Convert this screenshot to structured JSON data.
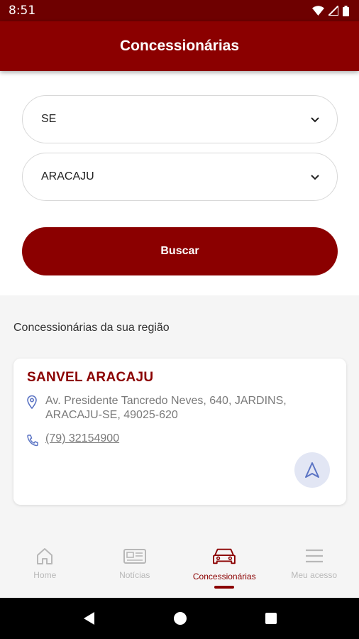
{
  "status_bar": {
    "time": "8:51"
  },
  "app_bar": {
    "title": "Concessionárias"
  },
  "form": {
    "state_select": {
      "value": "SE"
    },
    "city_select": {
      "value": "ARACAJU"
    },
    "search_button": {
      "label": "Buscar"
    }
  },
  "results": {
    "section_title": "Concessionárias da sua região",
    "dealers": [
      {
        "name": "SANVEL ARACAJU",
        "address": "Av. Presidente Tancredo Neves, 640, JARDINS, ARACAJU-SE, 49025-620",
        "phone": "(79) 32154900"
      }
    ]
  },
  "bottom_nav": {
    "items": [
      {
        "label": "Home",
        "icon": "home-icon",
        "active": false
      },
      {
        "label": "Notícias",
        "icon": "newspaper-icon",
        "active": false
      },
      {
        "label": "Concessionárias",
        "icon": "car-icon",
        "active": true
      },
      {
        "label": "Meu acesso",
        "icon": "menu-icon",
        "active": false
      }
    ]
  },
  "colors": {
    "brand": "#8b0000",
    "status_bar": "#6e0000",
    "muted_text": "#7a7a7a",
    "inactive_nav": "#b8b8b8",
    "icon_blue": "#5b74c4",
    "background": "#f5f5f5"
  }
}
